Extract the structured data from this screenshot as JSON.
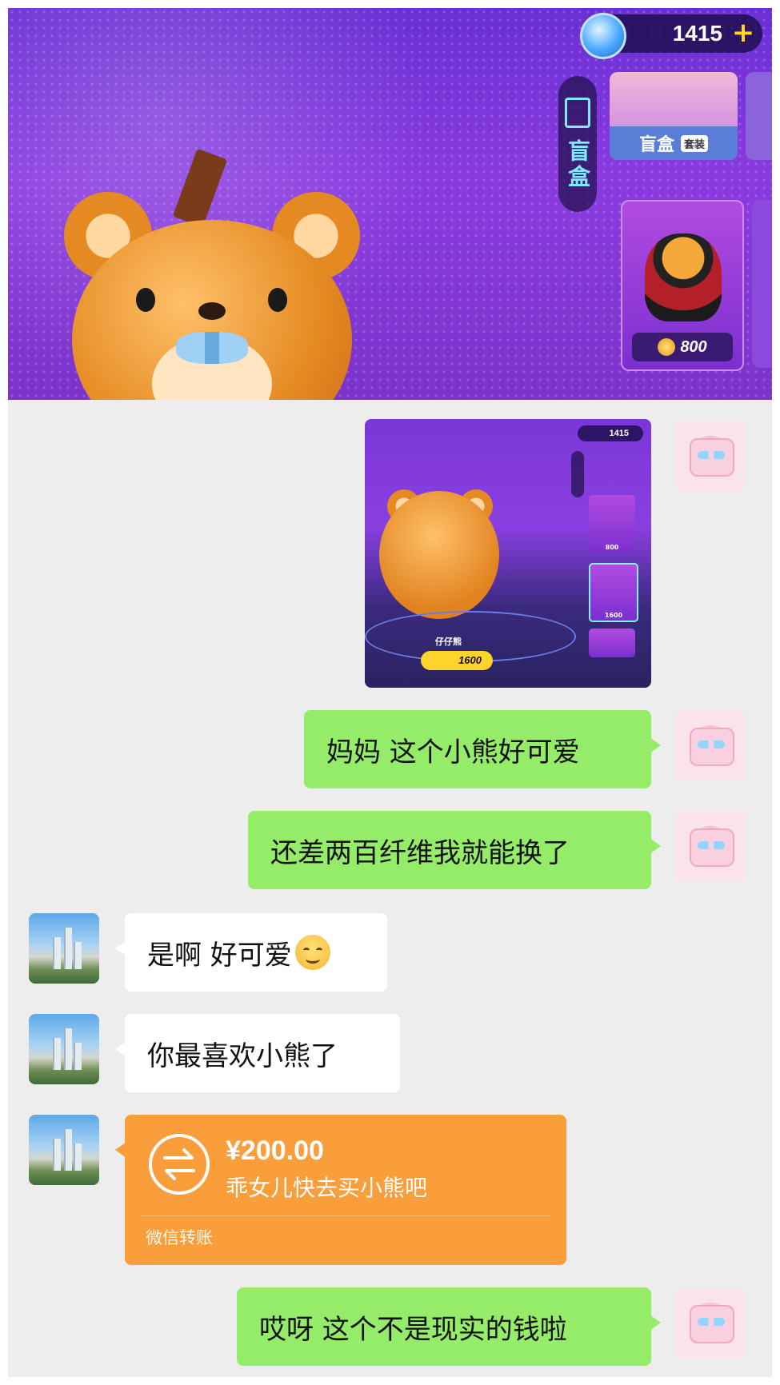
{
  "game": {
    "currency_value": "1415",
    "currency_plus": "+",
    "side_tab_label": "盲盒",
    "top_card_label": "盲盒",
    "top_card_badge": "套装",
    "tiger_price": "800"
  },
  "chat": {
    "shared_image": {
      "currency_value": "1415",
      "character_name": "仔仔熊",
      "price": "1600",
      "card_tiger_price": "800",
      "card_bear_price": "1600"
    },
    "messages": [
      {
        "from": "me",
        "text": "妈妈 这个小熊好可爱"
      },
      {
        "from": "me",
        "text": "还差两百纤维我就能换了"
      },
      {
        "from": "mom",
        "text": "是啊 好可爱",
        "emoji": "smile-emoji"
      },
      {
        "from": "mom",
        "text": "你最喜欢小熊了"
      },
      {
        "from": "me",
        "text": "哎呀 这个不是现实的钱啦"
      }
    ],
    "transfer": {
      "amount": "¥200.00",
      "note": "乖女儿快去买小熊吧",
      "label": "微信转账"
    }
  },
  "colors": {
    "green_bubble": "#95ec69",
    "transfer_orange": "#fa9d3b",
    "chat_background": "#ededed"
  }
}
